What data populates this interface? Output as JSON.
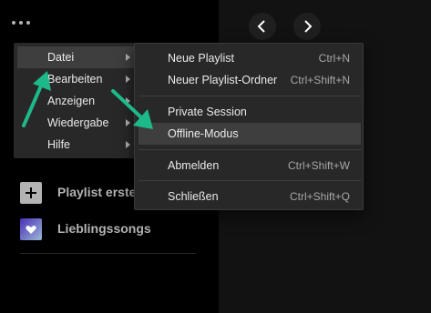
{
  "sidebar": {
    "items": [
      {
        "label": "Playlist erstellen",
        "icon": "plus-icon"
      },
      {
        "label": "Lieblingssongs",
        "icon": "heart-icon"
      }
    ]
  },
  "main_menu": {
    "items": [
      {
        "label": "Datei",
        "has_submenu": true
      },
      {
        "label": "Bearbeiten",
        "has_submenu": true
      },
      {
        "label": "Anzeigen",
        "has_submenu": true
      },
      {
        "label": "Wiedergabe",
        "has_submenu": true
      },
      {
        "label": "Hilfe",
        "has_submenu": true
      }
    ]
  },
  "file_menu": {
    "items": [
      {
        "label": "Neue Playlist",
        "shortcut": "Ctrl+N"
      },
      {
        "label": "Neuer Playlist-Ordner",
        "shortcut": "Ctrl+Shift+N"
      },
      {
        "label": "Private Session",
        "shortcut": ""
      },
      {
        "label": "Offline-Modus",
        "shortcut": ""
      },
      {
        "label": "Abmelden",
        "shortcut": "Ctrl+Shift+W"
      },
      {
        "label": "Schließen",
        "shortcut": "Ctrl+Shift+Q"
      }
    ],
    "highlighted": "Offline-Modus"
  },
  "icons": {
    "menu": "more-dots-icon",
    "back": "chevron-left-icon",
    "forward": "chevron-right-icon"
  },
  "colors": {
    "sidebar_bg": "#000000",
    "main_bg": "#121212",
    "menu_bg": "#282828",
    "menu_hover": "#3e3e3e",
    "annotation_arrow": "#1db98a",
    "liked_songs_gradient_start": "#4a2fb8",
    "liked_songs_gradient_end": "#9ab8d6"
  }
}
